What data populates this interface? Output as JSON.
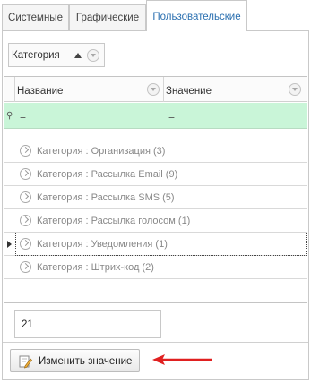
{
  "tabs": [
    {
      "label": "Системные",
      "active": false
    },
    {
      "label": "Графические",
      "active": false
    },
    {
      "label": "Пользовательские",
      "active": true
    }
  ],
  "groupby": {
    "label": "Категория",
    "sort": "ascending"
  },
  "grid": {
    "columns": [
      "Название",
      "Значение"
    ],
    "filter_row": {
      "name_op": "=",
      "value_op": "="
    },
    "groups": [
      {
        "label": "Категория : Организация (3)"
      },
      {
        "label": "Категория : Рассылка Email (9)"
      },
      {
        "label": "Категория : Рассылка SMS (5)"
      },
      {
        "label": "Категория : Рассылка голосом (1)"
      },
      {
        "label": "Категория : Уведомления (1)",
        "focused": true
      },
      {
        "label": "Категория : Штрих-код (2)"
      }
    ]
  },
  "value_field": {
    "value": "21"
  },
  "edit_button": {
    "label": "Изменить значение"
  },
  "colors": {
    "accent_tab_text": "#2a6fb0",
    "filter_row_bg": "#c9f5d8",
    "arrow": "#e02020"
  }
}
